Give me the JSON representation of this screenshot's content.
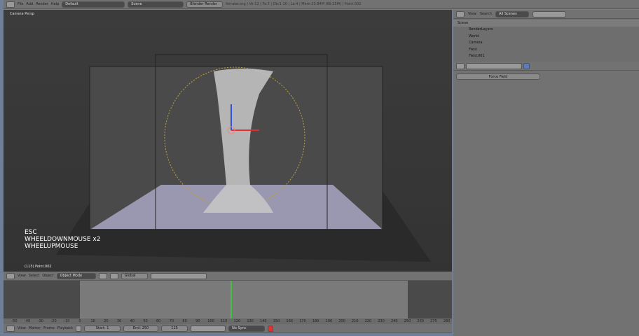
{
  "top_header": {
    "menus": [
      "File",
      "Add",
      "Render",
      "Help"
    ],
    "screen_layout": "Default",
    "scene": "Scene",
    "render_engine": "Blender Render",
    "info": "ferrater.org | Ve:12 | Fa:7 | Ob:1-10 | La:4 | Mem:23.84M (69.25M) | Point.002"
  },
  "viewport": {
    "view_label": "Camera Persp",
    "keys": [
      "ESC",
      "WHEELDOWNMOUSE x2",
      "WHEELUPMOUSE"
    ],
    "object_info": "(115) Point.002"
  },
  "view3d_header": {
    "menus": [
      "View",
      "Select",
      "Object"
    ],
    "mode": "Object Mode",
    "orientation": "Global"
  },
  "outliner": {
    "menus": [
      "View",
      "Search"
    ],
    "filter": "All Scenes",
    "items": [
      {
        "label": "Scene",
        "level": 0
      },
      {
        "label": "RenderLayers",
        "level": 1
      },
      {
        "label": "World",
        "level": 1
      },
      {
        "label": "Camera",
        "level": 1
      },
      {
        "label": "Field",
        "level": 1
      },
      {
        "label": "Field.001",
        "level": 1
      }
    ]
  },
  "properties": {
    "panel_button": "Force Field"
  },
  "timeline": {
    "ruler": [
      "-50",
      "-40",
      "-30",
      "-20",
      "-10",
      "0",
      "10",
      "20",
      "30",
      "40",
      "50",
      "60",
      "70",
      "80",
      "90",
      "100",
      "110",
      "120",
      "130",
      "140",
      "150",
      "160",
      "170",
      "180",
      "190",
      "200",
      "210",
      "220",
      "230",
      "240",
      "250",
      "260",
      "270",
      "280"
    ],
    "current_frame_value": 115,
    "menus": [
      "View",
      "Marker",
      "Frame",
      "Playback"
    ],
    "start": "Start: 1",
    "end": "End: 250",
    "current": "115",
    "sync": "No Sync"
  },
  "colors": {
    "frame_line": "#44c043",
    "accent": "#5680c2"
  }
}
